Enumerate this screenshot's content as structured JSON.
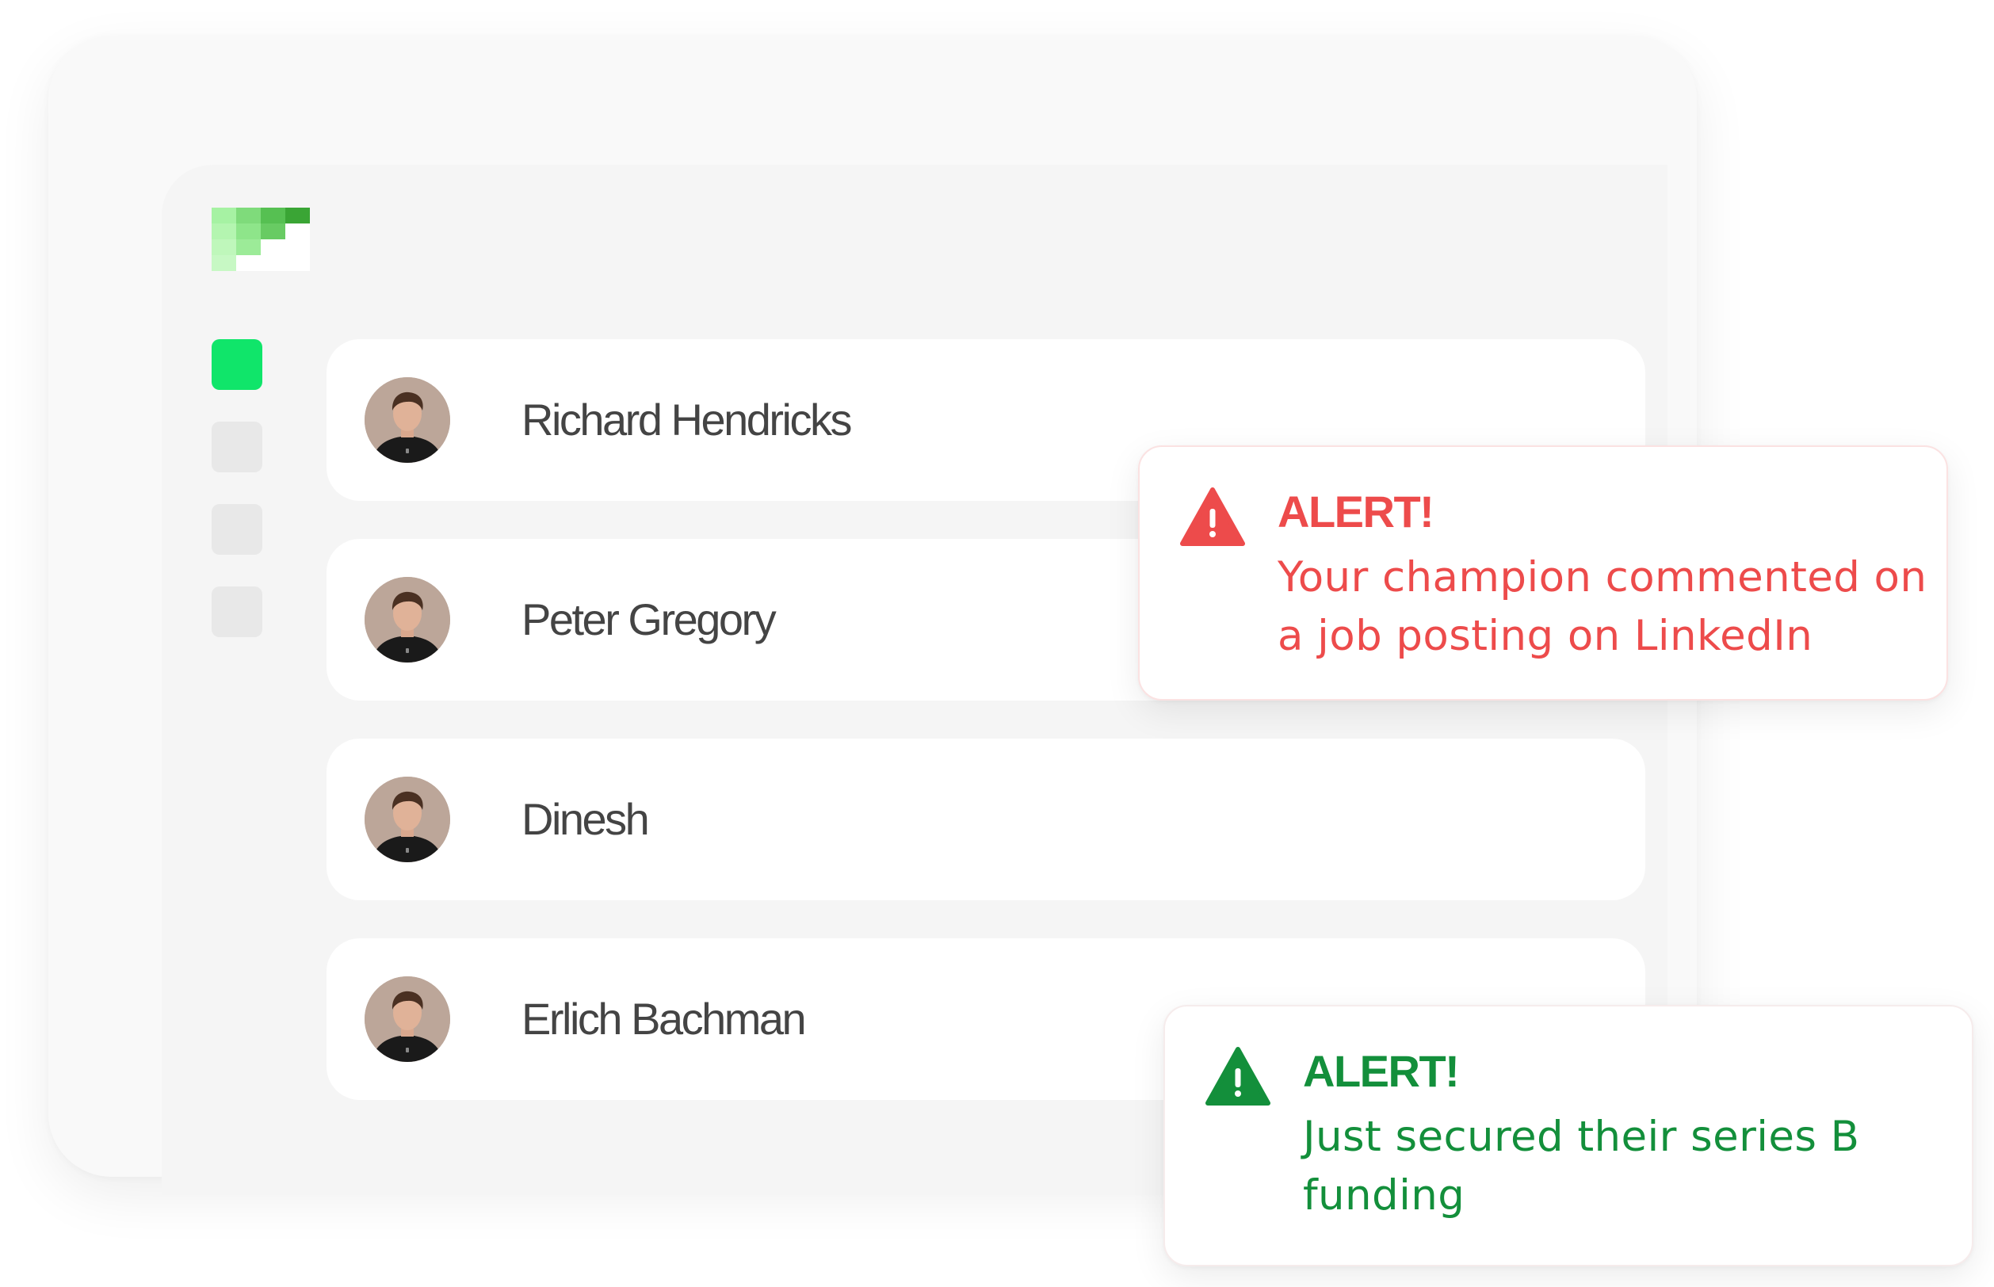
{
  "app": {
    "logo_icon": "logo-staircase-icon"
  },
  "sidebar": {
    "items": [
      {
        "icon": "nav-square-icon",
        "active": true,
        "color": "#10e56a"
      },
      {
        "icon": "nav-square-icon",
        "active": false,
        "color": "#e8e8e8"
      },
      {
        "icon": "nav-square-icon",
        "active": false,
        "color": "#e8e8e8"
      },
      {
        "icon": "nav-square-icon",
        "active": false,
        "color": "#e8e8e8"
      }
    ]
  },
  "contacts": [
    {
      "name": "Richard Hendricks",
      "avatar_icon": "profile-photo"
    },
    {
      "name": "Peter Gregory",
      "avatar_icon": "profile-photo"
    },
    {
      "name": "Dinesh",
      "avatar_icon": "profile-photo"
    },
    {
      "name": "Erlich Bachman",
      "avatar_icon": "profile-photo"
    }
  ],
  "alerts": [
    {
      "title": "ALERT!",
      "message": "Your champion commented on a job posting on LinkedIn",
      "icon": "warning-triangle-icon",
      "color": "#ed4b4b"
    },
    {
      "title": "ALERT!",
      "message": "Just secured their series B funding",
      "icon": "warning-triangle-icon",
      "color": "#138f3b"
    }
  ],
  "colors": {
    "accent_green": "#10e56a",
    "alert_red": "#ed4b4b",
    "alert_green": "#138f3b",
    "text_dark": "#444444"
  }
}
